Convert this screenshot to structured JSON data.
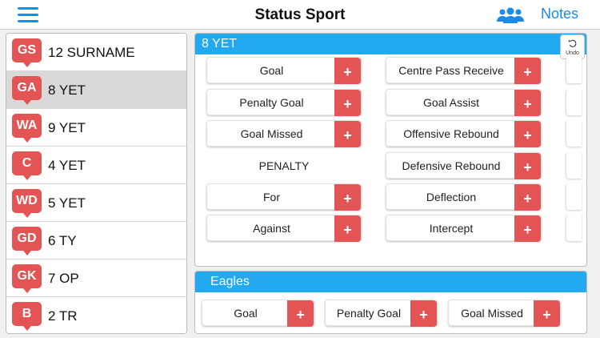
{
  "header": {
    "title": "Status Sport",
    "notes_label": "Notes"
  },
  "players": [
    {
      "position": "GS",
      "name": "12 SURNAME"
    },
    {
      "position": "GA",
      "name": "8 YET"
    },
    {
      "position": "WA",
      "name": "9 YET"
    },
    {
      "position": "C",
      "name": "4 YET"
    },
    {
      "position": "WD",
      "name": "5 YET"
    },
    {
      "position": "GD",
      "name": "6 TY"
    },
    {
      "position": "GK",
      "name": "7 OP"
    },
    {
      "position": "B",
      "name": "2 TR"
    }
  ],
  "player_panel": {
    "title": "8 YET",
    "undo_label": "Undo",
    "left_stats": [
      "Goal",
      "Penalty Goal",
      "Goal Missed"
    ],
    "penalty_heading": "PENALTY",
    "penalty_stats": [
      "For",
      "Against"
    ],
    "right_stats": [
      "Centre Pass Receive",
      "Goal Assist",
      "Offensive Rebound",
      "Defensive Rebound",
      "Deflection",
      "Intercept"
    ],
    "plus_symbol": "+"
  },
  "team_panel": {
    "title": "Eagles",
    "stats": [
      "Goal",
      "Penalty Goal",
      "Goal Missed"
    ]
  },
  "colors": {
    "accent_blue": "#1a8be8",
    "header_blue": "#22a9f0",
    "badge_red": "#e35555",
    "selected_row": "#d9d9d9"
  }
}
